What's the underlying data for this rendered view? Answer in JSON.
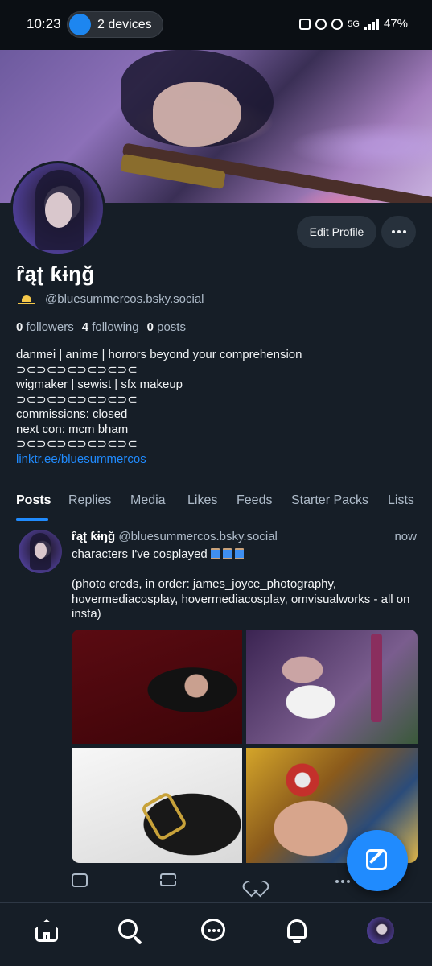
{
  "status_bar": {
    "time": "10:23",
    "devices": "2 devices",
    "battery": "47%",
    "network": "5G"
  },
  "profile": {
    "display_name": "ȓąʈ ƙɨŋğ",
    "handle": "@bluesummercos.bsky.social",
    "edit_label": "Edit Profile",
    "followers_count": "0",
    "followers_label": "followers",
    "following_count": "4",
    "following_label": "following",
    "posts_count": "0",
    "posts_label": "posts",
    "bio": [
      "danmei | anime | horrors beyond your comprehension",
      "⊃⊂⊃⊂⊃⊂⊃⊂⊃⊂⊃⊂",
      "wigmaker | sewist | sfx makeup",
      "⊃⊂⊃⊂⊃⊂⊃⊂⊃⊂⊃⊂",
      "commissions: closed",
      "next con: mcm bham",
      "⊃⊂⊃⊂⊃⊂⊃⊂⊃⊂⊃⊂"
    ],
    "link": "linktr.ee/bluesummercos"
  },
  "tabs": [
    "Posts",
    "Replies",
    "Media",
    "Likes",
    "Feeds",
    "Starter Packs",
    "Lists"
  ],
  "post": {
    "author_name": "ȓąʈ ƙɨŋğ",
    "author_handle": "@bluesummercos.bsky.social",
    "time": "now",
    "text_line1": "characters I've cosplayed",
    "text_line2": "(photo creds, in order: james_joyce_photography, hovermediacosplay, hovermediacosplay, omvisualworks - all on insta)"
  },
  "icons": {
    "nav": [
      "home-icon",
      "search-icon",
      "chat-icon",
      "bell-icon",
      "avatar"
    ],
    "post_actions": [
      "reply-icon",
      "repost-icon",
      "like-icon",
      "more-icon"
    ],
    "fab": "compose-icon"
  },
  "colors": {
    "background": "#161e27",
    "accent": "#208bfe",
    "muted_text": "#aebbc9",
    "button_bg": "#27313c"
  }
}
